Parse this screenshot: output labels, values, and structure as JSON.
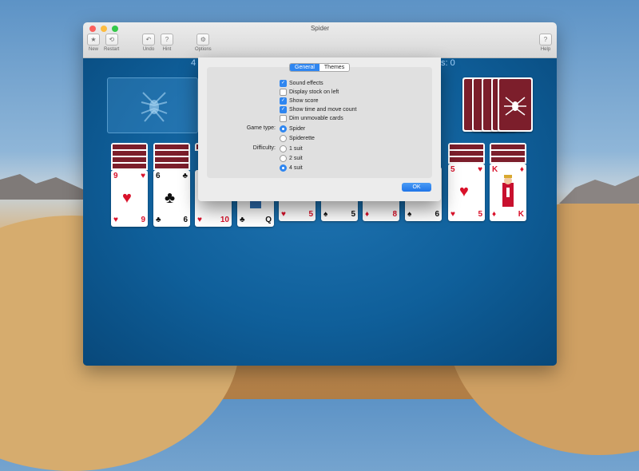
{
  "window": {
    "title": "Spider"
  },
  "toolbar": {
    "new": "New",
    "restart": "Restart",
    "undo": "Undo",
    "hint": "Hint",
    "options": "Options",
    "help": "Help"
  },
  "hud": {
    "left": "4",
    "right": "s: 0"
  },
  "dialog": {
    "tabs": [
      {
        "label": "General",
        "active": true
      },
      {
        "label": "Themes",
        "active": false
      }
    ],
    "checkboxes": [
      {
        "label": "Sound effects",
        "checked": true
      },
      {
        "label": "Display stock on left",
        "checked": false
      },
      {
        "label": "Show score",
        "checked": true
      },
      {
        "label": "Show time and move count",
        "checked": true
      },
      {
        "label": "Dim unmovable cards",
        "checked": false
      }
    ],
    "game_type": {
      "label": "Game type:",
      "options": [
        {
          "label": "Spider",
          "selected": true
        },
        {
          "label": "Spiderette",
          "selected": false
        }
      ]
    },
    "difficulty": {
      "label": "Difficulty:",
      "options": [
        {
          "label": "1 suit",
          "selected": false
        },
        {
          "label": "2 suit",
          "selected": false
        },
        {
          "label": "4 suit",
          "selected": true
        }
      ]
    },
    "ok_label": "OK"
  },
  "cards": {
    "c1": {
      "rank": "9",
      "suit": "♥",
      "color": "red"
    },
    "c2": {
      "rank": "6",
      "suit": "♣",
      "color": "blk"
    },
    "c3": {
      "rank": "10",
      "suit": "♥",
      "color": "red"
    },
    "c4": {
      "rank": "Q",
      "suit": "♣",
      "color": "blk"
    },
    "c5": {
      "rank": "5",
      "suit": "♥",
      "color": "red"
    },
    "c6": {
      "rank": "5",
      "suit": "♠",
      "color": "blk"
    },
    "c7": {
      "rank": "8",
      "suit": "♦",
      "color": "red"
    },
    "c8": {
      "rank": "6",
      "suit": "♠",
      "color": "blk"
    },
    "c9": {
      "rank": "5",
      "suit": "♥",
      "color": "red"
    },
    "c10": {
      "rank": "K",
      "suit": "♦",
      "color": "red"
    }
  }
}
